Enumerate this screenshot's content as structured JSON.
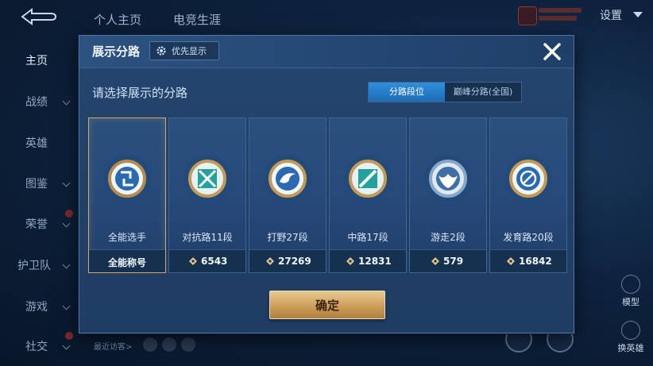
{
  "top_tabs": [
    "个人主页",
    "电竞生涯"
  ],
  "settings_label": "设置",
  "sidebar": {
    "items": [
      {
        "label": "主页",
        "active": true,
        "chevron": false
      },
      {
        "label": "战绩",
        "chevron": true
      },
      {
        "label": "英雄",
        "chevron": false
      },
      {
        "label": "图鉴",
        "chevron": true
      },
      {
        "label": "荣誉",
        "chevron": true
      },
      {
        "label": "护卫队",
        "chevron": true
      },
      {
        "label": "游戏",
        "chevron": true
      },
      {
        "label": "社交",
        "chevron": true
      }
    ]
  },
  "recent_visitors_label": "最近访客>",
  "side_buttons": {
    "model_label": "模型",
    "swap_hero_label": "换英雄"
  },
  "modal": {
    "title": "展示分路",
    "priority_label": "优先显示",
    "prompt": "请选择展示的分路",
    "segment_tabs": [
      {
        "label": "分路段位",
        "active": true
      },
      {
        "label": "巅峰分路(全国)",
        "active": false
      }
    ],
    "cards": [
      {
        "name": "全能选手",
        "footer_text": "全能称号",
        "selected": true,
        "emblem": "all-round-emblem",
        "ring": "#b98b4a"
      },
      {
        "name": "对抗路11段",
        "value": "6543",
        "emblem": "clash-lane-emblem",
        "ring": "#c49a55"
      },
      {
        "name": "打野27段",
        "value": "27269",
        "emblem": "jungle-emblem",
        "ring": "#c49a55"
      },
      {
        "name": "中路17段",
        "value": "12831",
        "emblem": "mid-lane-emblem",
        "ring": "#c49a55"
      },
      {
        "name": "游走2段",
        "value": "579",
        "emblem": "roam-emblem",
        "ring": "#8aa7c7"
      },
      {
        "name": "发育路20段",
        "value": "16842",
        "emblem": "farm-lane-emblem",
        "ring": "#c49a55"
      }
    ],
    "confirm_label": "确定"
  },
  "colors": {
    "accent_blue": "#2f8fdc",
    "gold": "#d9a864",
    "panel": "#24456f"
  }
}
